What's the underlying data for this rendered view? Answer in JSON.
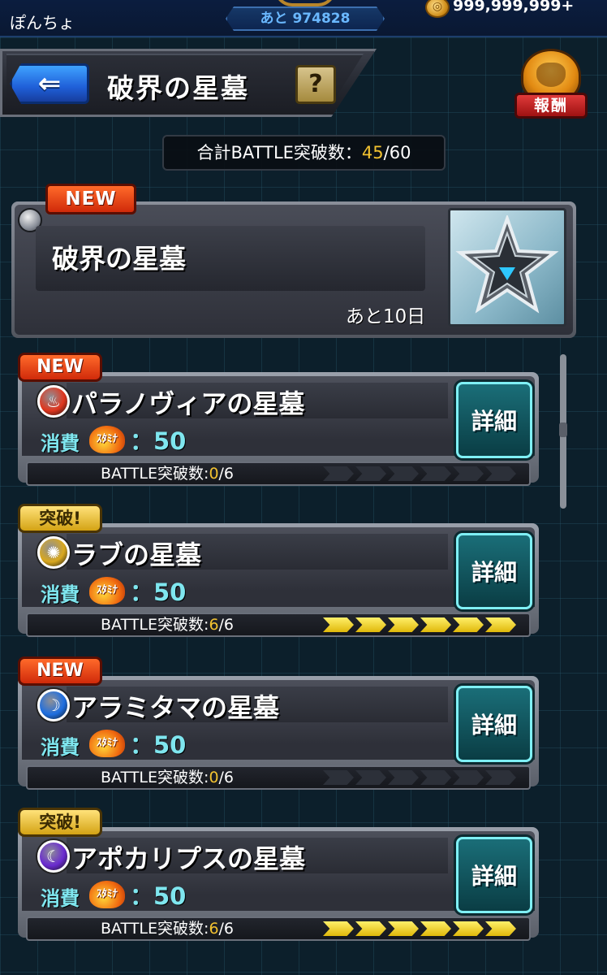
{
  "status": {
    "rank_text": "",
    "player_name": "ぽんちょ",
    "exp_remaining": "あと 974828",
    "coin_icon": "coin-icon",
    "coins": "999,999,999+"
  },
  "header": {
    "back_icon": "back-arrow-icon",
    "title": "破界の星墓",
    "help_label": "?",
    "reward_label": "報酬"
  },
  "total": {
    "prefix": "合計BATTLE突破数：",
    "cleared": "45",
    "separator": "/",
    "total": "60"
  },
  "event": {
    "badge": "NEW",
    "title": "破界の星墓",
    "remaining": "あと10日",
    "art_icon": "star-tomb-icon"
  },
  "quests": [
    {
      "badge": "NEW",
      "badge_type": "new",
      "attr": "fire",
      "attr_color": "#e0361e",
      "name": "パラノヴィアの星墓",
      "cost_label": "消費",
      "stamina_label": "ｽﾀﾐﾅ",
      "cost_value": "：50",
      "battle_label": "BATTLE突破数:",
      "battle_cleared": "0",
      "battle_total": "/6",
      "progress": 0,
      "detail_label": "詳細"
    },
    {
      "badge": "突破!",
      "badge_type": "cleared",
      "attr": "light",
      "attr_color": "#d9a81e",
      "name": "ラブの星墓",
      "cost_label": "消費",
      "stamina_label": "ｽﾀﾐﾅ",
      "cost_value": "：50",
      "battle_label": "BATTLE突破数:",
      "battle_cleared": "6",
      "battle_total": "/6",
      "progress": 6,
      "detail_label": "詳細"
    },
    {
      "badge": "NEW",
      "badge_type": "new",
      "attr": "water",
      "attr_color": "#1e6ee0",
      "name": "アラミタマの星墓",
      "cost_label": "消費",
      "stamina_label": "ｽﾀﾐﾅ",
      "cost_value": "：50",
      "battle_label": "BATTLE突破数:",
      "battle_cleared": "0",
      "battle_total": "/6",
      "progress": 0,
      "detail_label": "詳細"
    },
    {
      "badge": "突破!",
      "badge_type": "cleared",
      "attr": "dark",
      "attr_color": "#6a2ad0",
      "name": "アポカリプスの星墓",
      "cost_label": "消費",
      "stamina_label": "ｽﾀﾐﾅ",
      "cost_value": "：50",
      "battle_label": "BATTLE突破数:",
      "battle_cleared": "6",
      "battle_total": "/6",
      "progress": 6,
      "detail_label": "詳細"
    }
  ]
}
